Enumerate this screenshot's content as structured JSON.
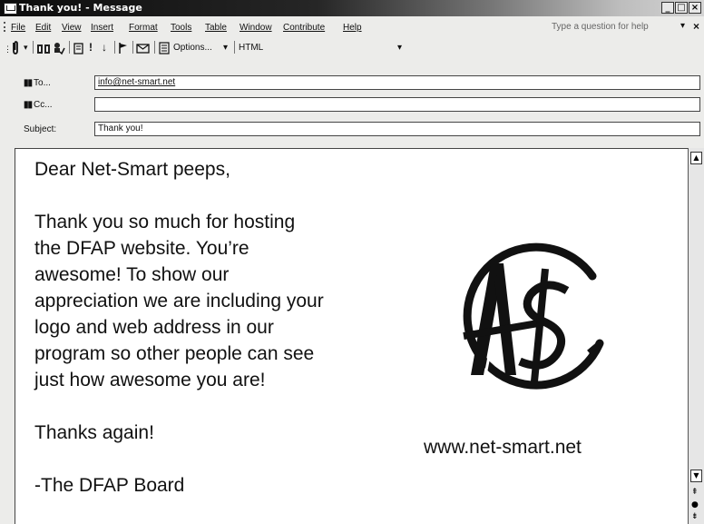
{
  "window": {
    "title": "Thank you! - Message",
    "controls": [
      "_",
      "□",
      "×"
    ]
  },
  "menubar": {
    "items": [
      "File",
      "Edit",
      "View",
      "Insert",
      "Format",
      "Tools",
      "Table",
      "Window",
      "Contribute",
      "Help"
    ],
    "question_placeholder": "Type a question for help",
    "dropdown_arrow": "▾",
    "close_label": "×"
  },
  "toolbar": {
    "options_label": "Options...",
    "format_label": "HTML",
    "dropdown_arrow": "▾"
  },
  "message": {
    "to_label": "To...",
    "to_value": "info@net-smart.net",
    "cc_label": "Cc...",
    "cc_value": "",
    "subject_label": "Subject:",
    "subject_value": "Thank you!"
  },
  "body": {
    "greeting": "Dear Net-Smart peeps,",
    "paragraph_lines": [
      "Thank you so much for hosting",
      "the DFAP website.  You’re",
      "awesome!  To show our",
      "appreciation we are including your",
      "logo and web address in our",
      "program so other people can see",
      "just how awesome you are!"
    ],
    "closing": "Thanks again!",
    "signature": "-The DFAP Board",
    "website": "www.net-smart.net",
    "logo_name": "net-smart-logo"
  },
  "icons": {
    "app": "message-icon",
    "attach": "paperclip-icon",
    "address_book": "address-book-icon",
    "check_names": "check-names-icon",
    "importance_high": "exclamation-icon",
    "importance_low": "down-arrow-icon",
    "flag": "flag-icon",
    "permission": "permission-icon",
    "options": "options-icon"
  }
}
